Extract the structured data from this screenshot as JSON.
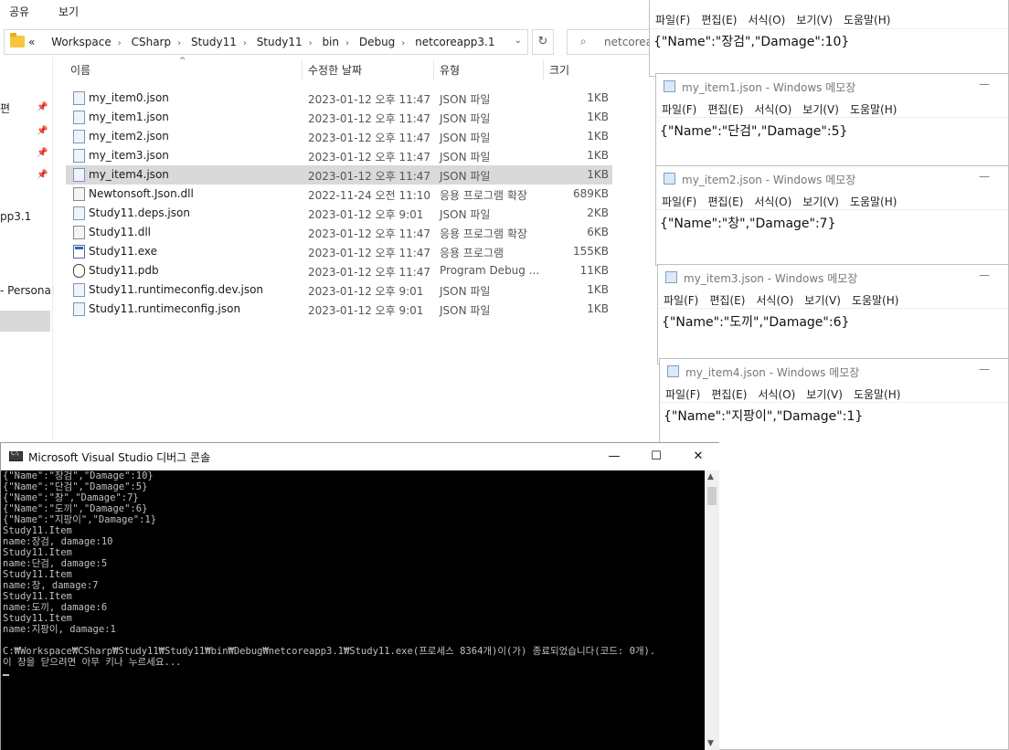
{
  "explorer": {
    "ribbon": [
      "공유",
      "보기"
    ],
    "breadcrumb": [
      "Workspace",
      "CSharp",
      "Study11",
      "Study11",
      "bin",
      "Debug",
      "netcoreapp3.1"
    ],
    "breadcrumb_prefix": "«",
    "search_placeholder": "netcorea",
    "nav": {
      "labels": [
        "편",
        "pp3.1",
        "- Personal"
      ]
    },
    "columns": {
      "name": "이름",
      "date": "수정한 날짜",
      "type": "유형",
      "size": "크기"
    },
    "files": [
      {
        "name": "my_item0.json",
        "date": "2023-01-12 오후 11:47",
        "type": "JSON 파일",
        "size": "1KB",
        "icon": "json-file-icon"
      },
      {
        "name": "my_item1.json",
        "date": "2023-01-12 오후 11:47",
        "type": "JSON 파일",
        "size": "1KB",
        "icon": "json-file-icon"
      },
      {
        "name": "my_item2.json",
        "date": "2023-01-12 오후 11:47",
        "type": "JSON 파일",
        "size": "1KB",
        "icon": "json-file-icon"
      },
      {
        "name": "my_item3.json",
        "date": "2023-01-12 오후 11:47",
        "type": "JSON 파일",
        "size": "1KB",
        "icon": "json-file-icon"
      },
      {
        "name": "my_item4.json",
        "date": "2023-01-12 오후 11:47",
        "type": "JSON 파일",
        "size": "1KB",
        "icon": "json-file-icon",
        "selected": true
      },
      {
        "name": "Newtonsoft.Json.dll",
        "date": "2022-11-24 오전 11:10",
        "type": "응용 프로그램 확장",
        "size": "689KB",
        "icon": "dll-file-icon"
      },
      {
        "name": "Study11.deps.json",
        "date": "2023-01-12 오후 9:01",
        "type": "JSON 파일",
        "size": "2KB",
        "icon": "json-file-icon"
      },
      {
        "name": "Study11.dll",
        "date": "2023-01-12 오후 11:47",
        "type": "응용 프로그램 확장",
        "size": "6KB",
        "icon": "dll-file-icon"
      },
      {
        "name": "Study11.exe",
        "date": "2023-01-12 오후 11:47",
        "type": "응용 프로그램",
        "size": "155KB",
        "icon": "exe-file-icon"
      },
      {
        "name": "Study11.pdb",
        "date": "2023-01-12 오후 11:47",
        "type": "Program Debug ...",
        "size": "11KB",
        "icon": "pdb-file-icon"
      },
      {
        "name": "Study11.runtimeconfig.dev.json",
        "date": "2023-01-12 오후 9:01",
        "type": "JSON 파일",
        "size": "1KB",
        "icon": "json-file-icon"
      },
      {
        "name": "Study11.runtimeconfig.json",
        "date": "2023-01-12 오후 9:01",
        "type": "JSON 파일",
        "size": "1KB",
        "icon": "json-file-icon"
      }
    ]
  },
  "notepad_menu": [
    "파일(F)",
    "편집(E)",
    "서식(O)",
    "보기(V)",
    "도움말(H)"
  ],
  "notepads": [
    {
      "title": "",
      "content": "{\"Name\":\"장검\",\"Damage\":10}"
    },
    {
      "title": "my_item1.json - Windows 메모장",
      "content": "{\"Name\":\"단검\",\"Damage\":5}"
    },
    {
      "title": "my_item2.json - Windows 메모장",
      "content": "{\"Name\":\"창\",\"Damage\":7}"
    },
    {
      "title": "my_item3.json - Windows 메모장",
      "content": "{\"Name\":\"도끼\",\"Damage\":6}"
    },
    {
      "title": "my_item4.json - Windows 메모장",
      "content": "{\"Name\":\"지팡이\",\"Damage\":1}"
    }
  ],
  "console": {
    "title": "Microsoft Visual Studio 디버그 콘솔",
    "minimize": "—",
    "maximize": "☐",
    "close": "✕",
    "lines": [
      "{\"Name\":\"장검\",\"Damage\":10}",
      "{\"Name\":\"단검\",\"Damage\":5}",
      "{\"Name\":\"창\",\"Damage\":7}",
      "{\"Name\":\"도끼\",\"Damage\":6}",
      "{\"Name\":\"지팡이\",\"Damage\":1}",
      "Study11.Item",
      "name:장검, damage:10",
      "Study11.Item",
      "name:단검, damage:5",
      "Study11.Item",
      "name:창, damage:7",
      "Study11.Item",
      "name:도끼, damage:6",
      "Study11.Item",
      "name:지팡이, damage:1",
      "",
      "C:₩Workspace₩CSharp₩Study11₩Study11₩bin₩Debug₩netcoreapp3.1₩Study11.exe(프로세스 8364개)이(가) 종료되었습니다(코드: 0개).",
      "이 창을 닫으려면 아무 키나 누르세요..."
    ]
  }
}
